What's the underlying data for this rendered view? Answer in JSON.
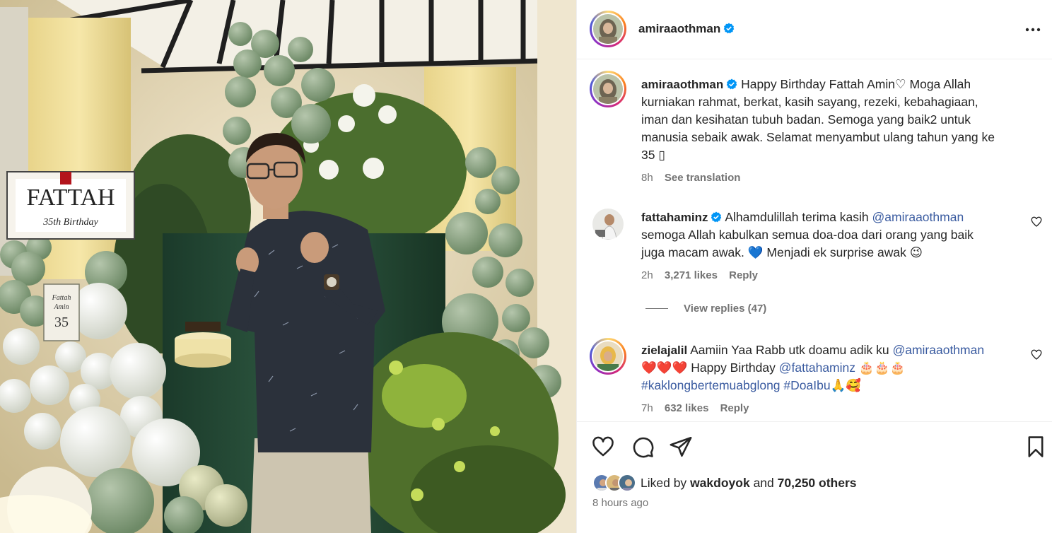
{
  "post": {
    "author": "amiraaothman",
    "verified": true,
    "more_icon": "more-horizontal-icon"
  },
  "caption": {
    "username": "amiraaothman",
    "line1": "Happy Birthday Fattah Amin♡ Moga Allah",
    "line2": "kurniakan rahmat, berkat, kasih sayang, rezeki, kebahagiaan,",
    "line3": "iman dan kesihatan tubuh badan. Semoga yang baik2 untuk",
    "line4": "manusia sebaik awak. Selamat menyambut ulang tahun yang ke",
    "line5": "35 ▯",
    "time": "8h",
    "see_translation": "See translation"
  },
  "comments": [
    {
      "username": "fattahaminz",
      "verified": true,
      "line1_text": "Alhamdulillah terima kasih",
      "line1_mention": "@amiraaothman",
      "line2": "semoga Allah kabulkan semua doa-doa dari orang yang baik",
      "line3": "juga macam awak. 💙 Menjadi ek surprise awak 😉",
      "time": "2h",
      "likes": "3,271 likes",
      "reply": "Reply",
      "view_replies": "View replies (47)"
    },
    {
      "username": "zielajalil",
      "verified": false,
      "line1_text": "Aamiin Yaa Rabb utk doamu adik ku",
      "line1_mention": "@amiraaothman",
      "line2_text": "❤️❤️❤️ Happy Birthday",
      "line2_mention": "@fattahaminz",
      "line2_after": "🎂🎂🎂",
      "line3_tag1": "#kaklongbertemuabglong",
      "line3_tag2": "#DoaIbu",
      "line3_after": "🙏🥰",
      "time": "7h",
      "likes": "632 likes",
      "reply": "Reply"
    }
  ],
  "actions": {
    "like_icon": "heart-icon",
    "comment_icon": "comment-icon",
    "share_icon": "share-icon",
    "save_icon": "bookmark-icon",
    "liked_by_prefix": "Liked by",
    "liked_by_user": "wakdoyok",
    "liked_by_and": "and",
    "liked_by_others": "70,250 others",
    "posted": "8 hours ago"
  },
  "photo": {
    "sign_name": "FATTAH",
    "sign_line": "35th Birthday",
    "card_line1": "Fattah",
    "card_line2": "Amin",
    "card_number": "35"
  },
  "colors": {
    "verified_blue": "#0095f6",
    "link_blue": "#3a5ba0",
    "muted": "#737373",
    "balloon_sage": "#8fa88a"
  }
}
